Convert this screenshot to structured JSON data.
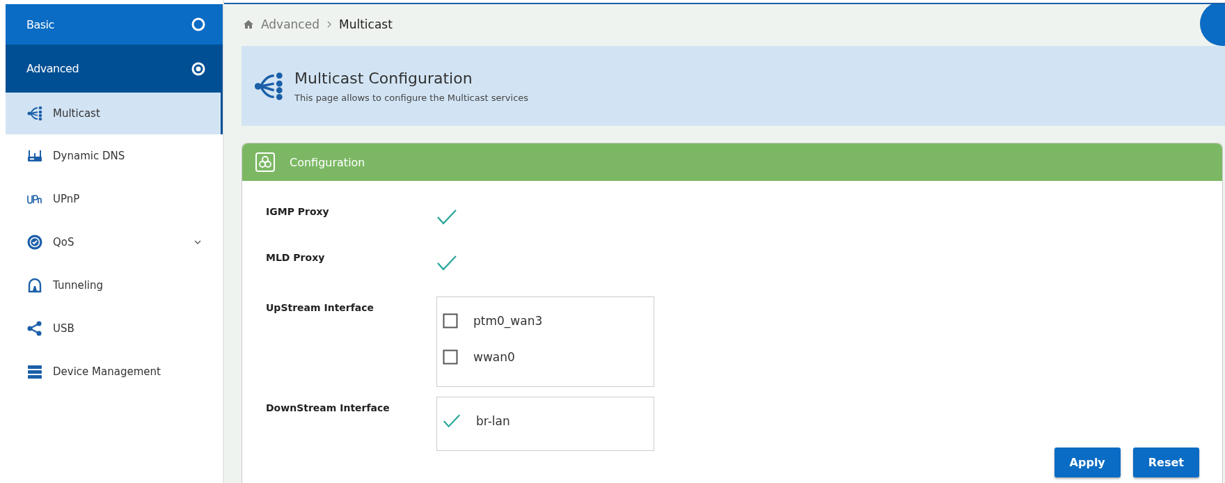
{
  "sidebar": {
    "sections": [
      {
        "label": "Basic",
        "selected": false
      },
      {
        "label": "Advanced",
        "selected": true,
        "items": [
          {
            "label": "Multicast",
            "kind": "multicast",
            "selected": true,
            "expandable": false
          },
          {
            "label": "Dynamic DNS",
            "kind": "router",
            "selected": false,
            "expandable": false
          },
          {
            "label": "UPnP",
            "kind": "upnp",
            "selected": false,
            "expandable": false
          },
          {
            "label": "QoS",
            "kind": "badge",
            "selected": false,
            "expandable": true
          },
          {
            "label": "Tunneling",
            "kind": "tunnel",
            "selected": false,
            "expandable": false
          },
          {
            "label": "USB",
            "kind": "share",
            "selected": false,
            "expandable": false
          },
          {
            "label": "Device Management",
            "kind": "server",
            "selected": false,
            "expandable": false
          }
        ]
      }
    ]
  },
  "breadcrumb": [
    "Advanced",
    "Multicast"
  ],
  "page_header": {
    "title": "Multicast Configuration",
    "subtitle": "This page allows to configure the Multicast services"
  },
  "card": {
    "title": "Configuration",
    "fields": [
      {
        "label": "IGMP Proxy",
        "kind": "check",
        "checked": true
      },
      {
        "label": "MLD Proxy",
        "kind": "check",
        "checked": true
      },
      {
        "label": "UpStream Interface",
        "kind": "list",
        "options": [
          {
            "label": "ptm0_wan3",
            "checked": false
          },
          {
            "label": "wwan0",
            "checked": false
          }
        ]
      },
      {
        "label": "DownStream Interface",
        "kind": "list",
        "options": [
          {
            "label": "br-lan",
            "checked": true
          }
        ]
      }
    ],
    "buttons": [
      "Apply",
      "Reset"
    ]
  }
}
